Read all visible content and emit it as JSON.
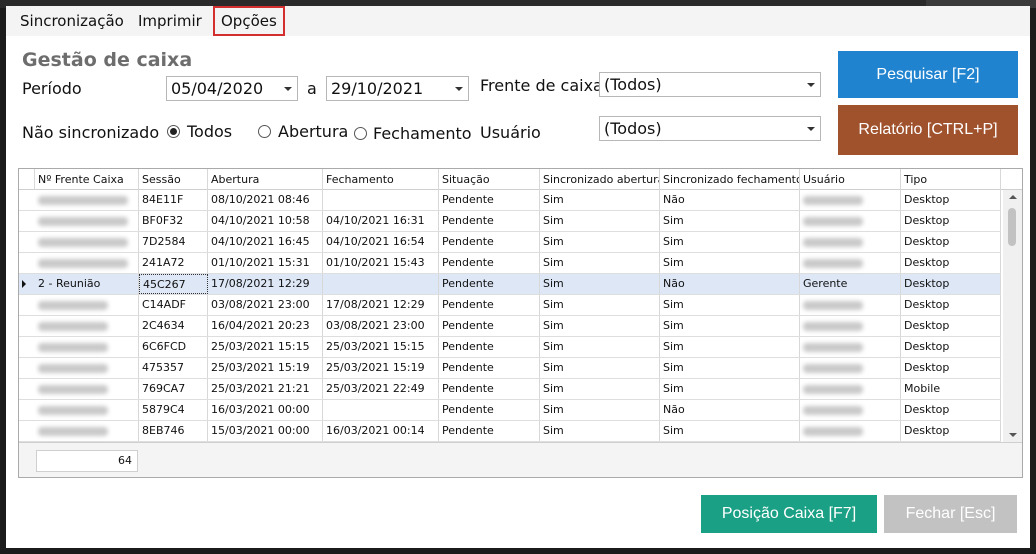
{
  "menu": {
    "items": [
      "Sincronização",
      "Imprimir",
      "Opções"
    ]
  },
  "page": {
    "title": "Gestão de caixa"
  },
  "filters": {
    "periodo_label": "Período",
    "date_from": "05/04/2020",
    "a_label": "a",
    "date_to": "29/10/2021",
    "frente_label": "Frente de caixa",
    "frente_value": "(Todos)",
    "nao_sinc_label": "Não sincronizado",
    "radio_todos": "Todos",
    "radio_abertura": "Abertura",
    "radio_fechamento": "Fechamento",
    "usuario_label": "Usuário",
    "usuario_value": "(Todos)"
  },
  "buttons": {
    "pesquisar": "Pesquisar [F2]",
    "relatorio": "Relatório [CTRL+P]",
    "posicao": "Posição Caixa [F7]",
    "fechar": "Fechar [Esc]"
  },
  "colors": {
    "pesquisar": "#1f83cf",
    "relatorio": "#a0522d",
    "posicao": "#1aa085",
    "fechar": "#c2c2c2",
    "highlight": "#d32f2f"
  },
  "grid": {
    "columns": [
      "Nº Frente Caixa",
      "Sessão",
      "Abertura",
      "Fechamento",
      "Situação",
      "Sincronizado abertura",
      "Sincronizado fechamento",
      "Usuário",
      "Tipo"
    ],
    "rows": [
      [
        "",
        "84E11F",
        "08/10/2021 08:46",
        "",
        "Pendente",
        "Sim",
        "Não",
        "",
        "Desktop"
      ],
      [
        "",
        "BF0F32",
        "04/10/2021 10:58",
        "04/10/2021 16:31",
        "Pendente",
        "Sim",
        "Sim",
        "",
        "Desktop"
      ],
      [
        "",
        "7D2584",
        "04/10/2021 16:45",
        "04/10/2021 16:54",
        "Pendente",
        "Sim",
        "Sim",
        "",
        "Desktop"
      ],
      [
        "",
        "241A72",
        "01/10/2021 15:31",
        "01/10/2021 15:43",
        "Pendente",
        "Sim",
        "Sim",
        "",
        "Desktop"
      ],
      [
        "2 - Reunião",
        "45C267",
        "17/08/2021 12:29",
        "",
        "Pendente",
        "Sim",
        "Não",
        "Gerente",
        "Desktop"
      ],
      [
        "",
        "C14ADF",
        "03/08/2021 23:00",
        "17/08/2021 12:29",
        "Pendente",
        "Sim",
        "Sim",
        "",
        "Desktop"
      ],
      [
        "",
        "2C4634",
        "16/04/2021 20:23",
        "03/08/2021 23:00",
        "Pendente",
        "Sim",
        "Sim",
        "",
        "Desktop"
      ],
      [
        "",
        "6C6FCD",
        "25/03/2021 15:15",
        "25/03/2021 15:15",
        "Pendente",
        "Sim",
        "Sim",
        "",
        "Desktop"
      ],
      [
        "",
        "475357",
        "25/03/2021 15:19",
        "25/03/2021 15:19",
        "Pendente",
        "Sim",
        "Sim",
        "",
        "Desktop"
      ],
      [
        "",
        "769CA7",
        "25/03/2021 21:21",
        "25/03/2021 22:49",
        "Pendente",
        "Sim",
        "Sim",
        "",
        "Mobile"
      ],
      [
        "",
        "5879C4",
        "16/03/2021 00:00",
        "",
        "Pendente",
        "Sim",
        "Não",
        "",
        "Desktop"
      ],
      [
        "",
        "8EB746",
        "15/03/2021 00:00",
        "16/03/2021 00:14",
        "Pendente",
        "Sim",
        "Sim",
        "",
        "Desktop"
      ]
    ],
    "total": "64"
  }
}
